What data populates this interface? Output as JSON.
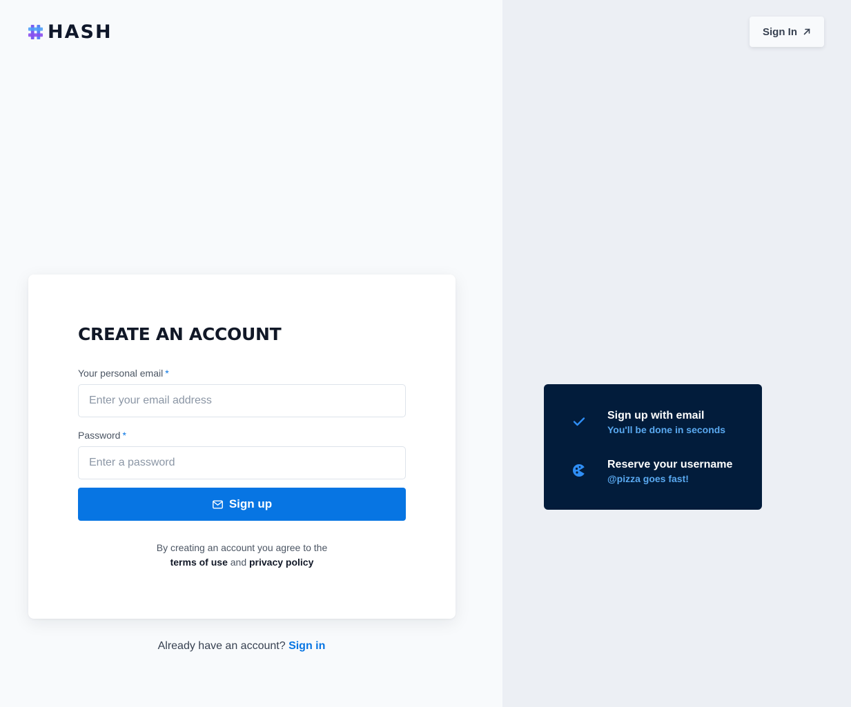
{
  "brand": {
    "name": "HASH",
    "accent": "#0775e3",
    "dark_panel": "#021c3b",
    "icon": "hash-logo-icon"
  },
  "header": {
    "signin_label": "Sign In",
    "signin_icon": "arrow-up-right-icon"
  },
  "form": {
    "title": "CREATE AN ACCOUNT",
    "email_label": "Your personal email",
    "email_placeholder": "Enter your email address",
    "email_value": "",
    "password_label": "Password",
    "password_placeholder": "Enter a password",
    "password_value": "",
    "required_marker": "*",
    "submit_label": "Sign up",
    "submit_icon": "mail-icon",
    "terms_prefix": "By creating an account you agree to the",
    "terms_link": "terms of use",
    "terms_and": "and",
    "privacy_link": "privacy policy"
  },
  "footer": {
    "prompt": "Already have an account?",
    "signin_link": "Sign in"
  },
  "features": [
    {
      "title": "Sign up with email",
      "subtitle": "You'll be done in seconds",
      "icon": "check-icon"
    },
    {
      "title": "Reserve your username",
      "subtitle": "@pizza goes fast!",
      "icon": "pizza-icon"
    }
  ]
}
